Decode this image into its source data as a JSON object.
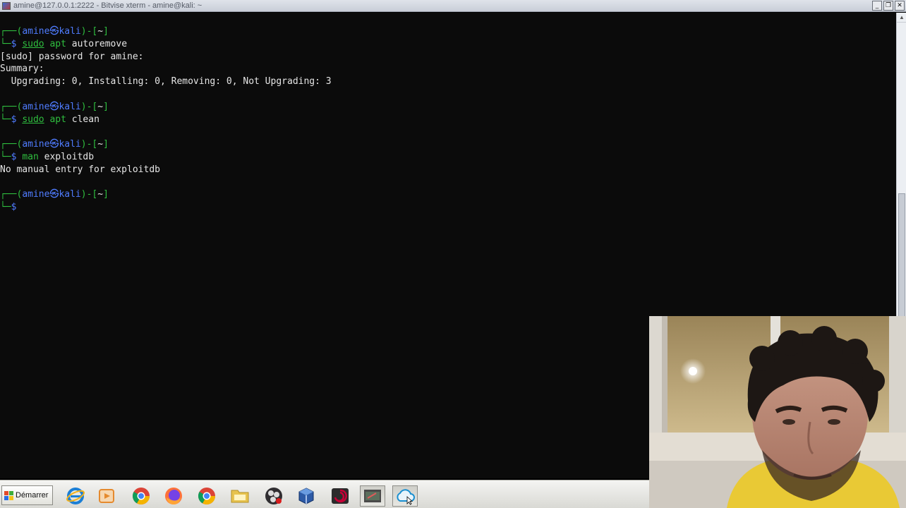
{
  "window": {
    "title": "amine@127.0.0.1:2222 - Bitvise xterm - amine@kali: ~",
    "buttons": [
      "_",
      "❐",
      "✕"
    ]
  },
  "terminal": {
    "lines": [
      {
        "type": "prompt-top",
        "user": "amine",
        "host": "kali",
        "dir": "~"
      },
      {
        "type": "command",
        "parts": [
          {
            "t": "sudo",
            "c": "u"
          },
          {
            "t": " apt ",
            "c": "g"
          },
          {
            "t": "autoremove",
            "c": "w"
          }
        ]
      },
      {
        "type": "output",
        "text": "[sudo] password for amine:"
      },
      {
        "type": "output",
        "text": "Summary:"
      },
      {
        "type": "output",
        "text": "  Upgrading: 0, Installing: 0, Removing: 0, Not Upgrading: 3"
      },
      {
        "type": "blank"
      },
      {
        "type": "prompt-top",
        "user": "amine",
        "host": "kali",
        "dir": "~"
      },
      {
        "type": "command",
        "parts": [
          {
            "t": "sudo",
            "c": "u"
          },
          {
            "t": " apt ",
            "c": "g"
          },
          {
            "t": "clean",
            "c": "w"
          }
        ]
      },
      {
        "type": "blank"
      },
      {
        "type": "prompt-top",
        "user": "amine",
        "host": "kali",
        "dir": "~"
      },
      {
        "type": "command",
        "parts": [
          {
            "t": "man",
            "c": "g"
          },
          {
            "t": " exploitdb",
            "c": "w"
          }
        ]
      },
      {
        "type": "output",
        "text": "No manual entry for exploitdb"
      },
      {
        "type": "blank"
      },
      {
        "type": "prompt-top",
        "user": "amine",
        "host": "kali",
        "dir": "~"
      },
      {
        "type": "command",
        "parts": []
      }
    ]
  },
  "taskbar": {
    "start_label": "Démarrer",
    "icons": [
      {
        "name": "internet-explorer-icon",
        "color": "#1c7fd6"
      },
      {
        "name": "media-player-icon",
        "color": "#e58a2e"
      },
      {
        "name": "chrome-icon",
        "color": "#db4437"
      },
      {
        "name": "firefox-icon",
        "color": "#ff7139"
      },
      {
        "name": "chrome-icon-2",
        "color": "#db4437"
      },
      {
        "name": "folder-icon",
        "color": "#e7c34f"
      },
      {
        "name": "obs-icon",
        "color": "#302e31"
      },
      {
        "name": "virtualbox-icon",
        "color": "#2d5aa6"
      },
      {
        "name": "debian-icon",
        "color": "#c70036"
      },
      {
        "name": "editor-icon",
        "color": "#4a4a4a"
      },
      {
        "name": "cloud-icon",
        "color": "#1a8fd0"
      }
    ]
  },
  "colors": {
    "prompt_green": "#2fbf3f",
    "prompt_blue": "#4f7cff",
    "terminal_bg": "#0b0b0b"
  }
}
